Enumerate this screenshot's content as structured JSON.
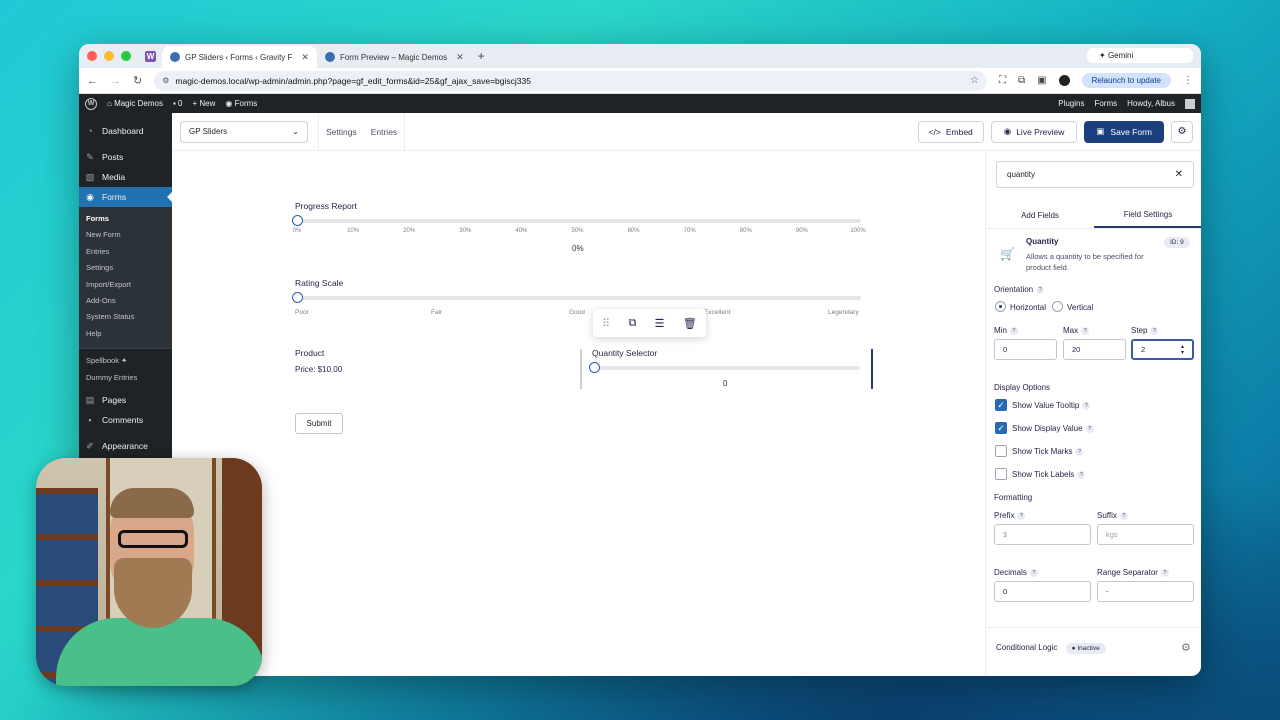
{
  "browser": {
    "tabs": [
      {
        "title": "GP Sliders ‹ Forms ‹ Gravity F"
      },
      {
        "title": "Form Preview – Magic Demos"
      }
    ],
    "url": "magic-demos.local/wp-admin/admin.php?page=gf_edit_forms&id=25&gf_ajax_save=bgiscj335",
    "relaunch_label": "Relaunch to update",
    "gemini_label": "Gemini"
  },
  "adminbar": {
    "site_name": "Magic Demos",
    "comments_count": "0",
    "new_label": "New",
    "forms_label": "Forms",
    "right": {
      "plugins": "Plugins",
      "forms": "Forms",
      "howdy": "Howdy, Albus"
    }
  },
  "sidebar": {
    "dashboard": "Dashboard",
    "posts": "Posts",
    "media": "Media",
    "forms": "Forms",
    "forms_sub": [
      "Forms",
      "New Form",
      "Entries",
      "Settings",
      "Import/Export",
      "Add-Ons",
      "System Status",
      "Help"
    ],
    "extra": [
      "Spellbook ✦",
      "Dummy Entries"
    ],
    "pages": "Pages",
    "comments": "Comments",
    "appearance": "Appearance"
  },
  "gf_toolbar": {
    "form_select": "GP Sliders",
    "links": [
      "Settings",
      "Entries"
    ],
    "embed": "Embed",
    "live_preview": "Live Preview",
    "save": "Save Form"
  },
  "form": {
    "progress_label": "Progress Report",
    "progress_value": 0,
    "progress_ticks": [
      "0%",
      "10%",
      "20%",
      "30%",
      "40%",
      "50%",
      "60%",
      "70%",
      "80%",
      "90%",
      "100%"
    ],
    "progress_display": "0%",
    "rating_label": "Rating Scale",
    "rating_scale": [
      "Poor",
      "Fair",
      "Good",
      "Excellent",
      "Legendary"
    ],
    "product_label": "Product",
    "price_text": "Price: $10.00",
    "quantity_label": "Quantity Selector",
    "quantity_display": "0",
    "submit_label": "Submit"
  },
  "panel": {
    "search_value": "quantity",
    "tabs": [
      "Add Fields",
      "Field Settings"
    ],
    "field_title": "Quantity",
    "field_desc": "Allows a quantity to be specified for product field.",
    "field_id": "ID: 9",
    "orientation_label": "Orientation",
    "orientation_options": [
      "Horizontal",
      "Vertical"
    ],
    "min_label": "Min",
    "max_label": "Max",
    "step_label": "Step",
    "min_value": "0",
    "max_value": "20",
    "step_value": "2",
    "display_options_label": "Display Options",
    "display_options": [
      {
        "label": "Show Value Tooltip",
        "checked": true
      },
      {
        "label": "Show Display Value",
        "checked": true
      },
      {
        "label": "Show Tick Marks",
        "checked": false
      },
      {
        "label": "Show Tick Labels",
        "checked": false
      }
    ],
    "formatting_label": "Formatting",
    "prefix_label": "Prefix",
    "suffix_label": "Suffix",
    "prefix_placeholder": "$",
    "suffix_placeholder": "kgs",
    "decimals_label": "Decimals",
    "range_sep_label": "Range Separator",
    "decimals_value": "0",
    "range_sep_value": "-",
    "conditional_logic": "Conditional Logic",
    "inactive": "Inactive"
  }
}
